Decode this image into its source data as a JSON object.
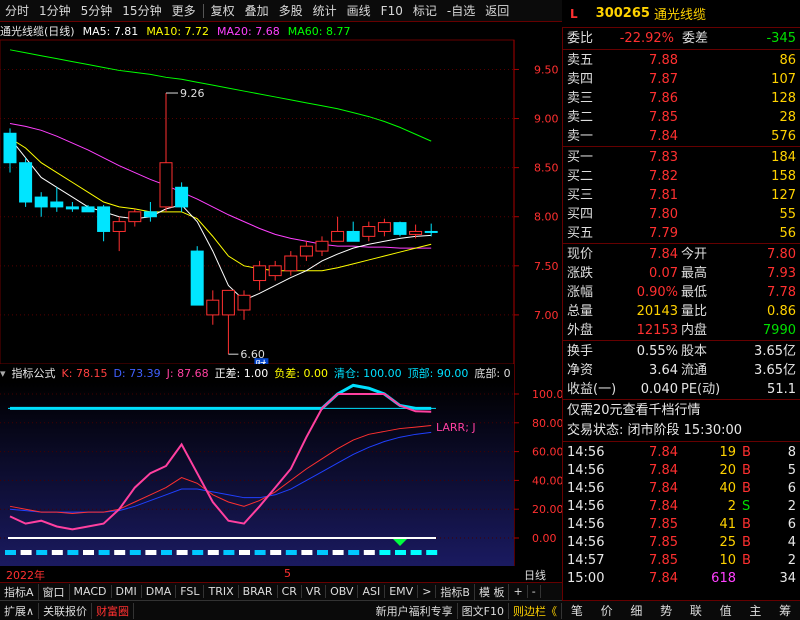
{
  "toolbar": {
    "items": [
      "分时",
      "1分钟",
      "5分钟",
      "15分钟",
      "更多",
      "复权",
      "叠加",
      "多股",
      "统计",
      "画线",
      "F10",
      "标记",
      "-自选",
      "返回"
    ]
  },
  "stock": {
    "market_flag": "L",
    "code": "300265",
    "name": "通光线缆"
  },
  "chart": {
    "title": "通光线缆(日线)",
    "ma5": "MA5: 7.81",
    "ma10": "MA10: 7.72",
    "ma20": "MA20: 7.68",
    "ma60": "MA60: 8.77",
    "high_label": "9.26",
    "low_label": "6.60",
    "fin_marker": "财",
    "price_ticks": [
      "9.50",
      "9.00",
      "8.50",
      "8.00",
      "7.50",
      "7.00"
    ],
    "colors": {
      "up": "#ff3030",
      "down": "#00e5ff",
      "ma5": "#ffffff",
      "ma10": "#ffff00",
      "ma20": "#ff40ff",
      "ma60": "#00ff00"
    }
  },
  "indicator": {
    "name": "指标公式",
    "k": "K: 78.15",
    "d": "D: 73.39",
    "j": "J: 87.68",
    "zhengcha": "正差: 1.00",
    "fucha": "负差: 0.00",
    "qingcang": "清仓: 100.00",
    "dingbu": "顶部: 90.00",
    "dibu": "底部: 0",
    "larr_label": "LARR; J",
    "ticks": [
      "100.0",
      "80.00",
      "60.00",
      "40.00",
      "20.00",
      "0.00"
    ]
  },
  "chart_data": {
    "type": "candlestick",
    "title": "通光线缆(日线)",
    "ylim": [
      6.5,
      9.8
    ],
    "ohlc": [
      [
        8.85,
        8.9,
        8.45,
        8.55
      ],
      [
        8.55,
        8.6,
        8.1,
        8.15
      ],
      [
        8.2,
        8.25,
        8.0,
        8.1
      ],
      [
        8.15,
        8.3,
        8.05,
        8.1
      ],
      [
        8.1,
        8.15,
        8.05,
        8.08
      ],
      [
        8.1,
        8.12,
        8.05,
        8.05
      ],
      [
        8.1,
        8.12,
        7.75,
        7.85
      ],
      [
        7.85,
        8.0,
        7.65,
        7.95
      ],
      [
        7.95,
        8.08,
        7.9,
        8.05
      ],
      [
        8.05,
        8.15,
        7.95,
        8.0
      ],
      [
        8.1,
        9.26,
        8.05,
        8.55
      ],
      [
        8.3,
        8.35,
        8.05,
        8.1
      ],
      [
        7.65,
        7.7,
        7.1,
        7.1
      ],
      [
        7.0,
        7.25,
        6.9,
        7.15
      ],
      [
        7.0,
        7.1,
        6.6,
        7.25
      ],
      [
        7.05,
        7.25,
        6.95,
        7.2
      ],
      [
        7.35,
        7.55,
        7.25,
        7.5
      ],
      [
        7.4,
        7.55,
        7.35,
        7.5
      ],
      [
        7.45,
        7.65,
        7.4,
        7.6
      ],
      [
        7.6,
        7.75,
        7.55,
        7.7
      ],
      [
        7.65,
        7.8,
        7.6,
        7.75
      ],
      [
        7.75,
        8.0,
        7.75,
        7.85
      ],
      [
        7.85,
        7.95,
        7.75,
        7.75
      ],
      [
        7.8,
        7.95,
        7.75,
        7.9
      ],
      [
        7.85,
        7.98,
        7.8,
        7.94
      ],
      [
        7.94,
        7.95,
        7.8,
        7.82
      ],
      [
        7.82,
        7.92,
        7.78,
        7.85
      ],
      [
        7.85,
        7.93,
        7.8,
        7.84
      ]
    ],
    "ma5": [
      8.8,
      8.6,
      8.4,
      8.3,
      8.2,
      8.1,
      8.05,
      8.0,
      7.98,
      8.0,
      8.08,
      8.12,
      7.95,
      7.65,
      7.3,
      7.15,
      7.22,
      7.3,
      7.38,
      7.45,
      7.55,
      7.62,
      7.68,
      7.72,
      7.75,
      7.78,
      7.8,
      7.81
    ],
    "ma10": [
      8.8,
      8.7,
      8.55,
      8.45,
      8.35,
      8.25,
      8.15,
      8.1,
      8.08,
      8.05,
      8.05,
      8.05,
      7.98,
      7.8,
      7.6,
      7.5,
      7.47,
      7.45,
      7.45,
      7.45,
      7.45,
      7.48,
      7.52,
      7.56,
      7.6,
      7.64,
      7.68,
      7.72
    ],
    "ma20": [
      8.95,
      8.92,
      8.88,
      8.82,
      8.75,
      8.68,
      8.6,
      8.52,
      8.45,
      8.38,
      8.32,
      8.25,
      8.18,
      8.1,
      8.02,
      7.95,
      7.88,
      7.82,
      7.78,
      7.75,
      7.72,
      7.7,
      7.7,
      7.69,
      7.69,
      7.68,
      7.68,
      7.68
    ],
    "ma60": [
      9.7,
      9.67,
      9.64,
      9.61,
      9.58,
      9.55,
      9.52,
      9.49,
      9.47,
      9.45,
      9.42,
      9.4,
      9.37,
      9.34,
      9.31,
      9.28,
      9.25,
      9.22,
      9.19,
      9.16,
      9.13,
      9.1,
      9.06,
      9.02,
      8.97,
      8.91,
      8.84,
      8.77
    ],
    "indicator_k": [
      22,
      20,
      18,
      18,
      17,
      18,
      18,
      20,
      25,
      30,
      35,
      42,
      38,
      30,
      25,
      22,
      26,
      32,
      40,
      48,
      55,
      62,
      68,
      72,
      74,
      76,
      77,
      78.15
    ],
    "indicator_d": [
      20,
      19,
      18,
      18,
      18,
      18,
      18,
      19,
      22,
      26,
      30,
      34,
      34,
      32,
      30,
      28,
      28,
      30,
      34,
      40,
      46,
      52,
      58,
      63,
      67,
      70,
      72,
      73.39
    ],
    "indicator_j": [
      15,
      10,
      12,
      8,
      6,
      8,
      10,
      20,
      35,
      45,
      50,
      65,
      45,
      25,
      12,
      10,
      22,
      35,
      48,
      70,
      90,
      100,
      106,
      104,
      100,
      92,
      88,
      87.68
    ]
  },
  "quote": {
    "weibi_label": "委比",
    "weibi": "-22.92%",
    "weicha_label": "委差",
    "weicha": "-345",
    "asks": [
      {
        "label": "卖五",
        "price": "7.88",
        "vol": "86"
      },
      {
        "label": "卖四",
        "price": "7.87",
        "vol": "107"
      },
      {
        "label": "卖三",
        "price": "7.86",
        "vol": "128"
      },
      {
        "label": "卖二",
        "price": "7.85",
        "vol": "28"
      },
      {
        "label": "卖一",
        "price": "7.84",
        "vol": "576"
      }
    ],
    "bids": [
      {
        "label": "买一",
        "price": "7.83",
        "vol": "184"
      },
      {
        "label": "买二",
        "price": "7.82",
        "vol": "158"
      },
      {
        "label": "买三",
        "price": "7.81",
        "vol": "127"
      },
      {
        "label": "买四",
        "price": "7.80",
        "vol": "55"
      },
      {
        "label": "买五",
        "price": "7.79",
        "vol": "56"
      }
    ],
    "stats": [
      {
        "l1": "现价",
        "v1": "7.84",
        "c1": "red",
        "l2": "今开",
        "v2": "7.80",
        "c2": "red"
      },
      {
        "l1": "涨跌",
        "v1": "0.07",
        "c1": "red",
        "l2": "最高",
        "v2": "7.93",
        "c2": "red"
      },
      {
        "l1": "涨幅",
        "v1": "0.90%",
        "c1": "red",
        "l2": "最低",
        "v2": "7.78",
        "c2": "red"
      },
      {
        "l1": "总量",
        "v1": "20143",
        "c1": "yellow",
        "l2": "量比",
        "v2": "0.86",
        "c2": "yellow"
      },
      {
        "l1": "外盘",
        "v1": "12153",
        "c1": "red",
        "l2": "内盘",
        "v2": "7990",
        "c2": "green"
      }
    ],
    "stats2": [
      {
        "l1": "换手",
        "v1": "0.55%",
        "c1": "white",
        "l2": "股本",
        "v2": "3.65亿",
        "c2": "white"
      },
      {
        "l1": "净资",
        "v1": "3.64",
        "c1": "white",
        "l2": "流通",
        "v2": "3.65亿",
        "c2": "white"
      },
      {
        "l1": "收益(一)",
        "v1": "0.040",
        "c1": "white",
        "l2": "PE(动)",
        "v2": "51.1",
        "c2": "white"
      }
    ],
    "promo": "仅需20元查看千档行情",
    "trade_state": "交易状态: 闭市阶段 15:30:00",
    "ticks": [
      {
        "t": "14:56",
        "p": "7.84",
        "v": "19",
        "s": "B",
        "n": "8"
      },
      {
        "t": "14:56",
        "p": "7.84",
        "v": "20",
        "s": "B",
        "n": "5"
      },
      {
        "t": "14:56",
        "p": "7.84",
        "v": "40",
        "s": "B",
        "n": "6"
      },
      {
        "t": "14:56",
        "p": "7.84",
        "v": "2",
        "s": "S",
        "n": "2"
      },
      {
        "t": "14:56",
        "p": "7.85",
        "v": "41",
        "s": "B",
        "n": "6"
      },
      {
        "t": "14:56",
        "p": "7.85",
        "v": "25",
        "s": "B",
        "n": "4"
      },
      {
        "t": "14:57",
        "p": "7.85",
        "v": "10",
        "s": "B",
        "n": "2"
      },
      {
        "t": "15:00",
        "p": "7.84",
        "v": "618",
        "s": "",
        "n": "34"
      }
    ]
  },
  "date_row": {
    "year": "2022年",
    "month": "5",
    "period": "日线"
  },
  "tabs": [
    "指标A",
    "窗口",
    "MACD",
    "DMI",
    "DMA",
    "FSL",
    "TRIX",
    "BRAR",
    "CR",
    "VR",
    "OBV",
    "ASI",
    "EMV",
    ">",
    "指标B",
    "模 板",
    "+",
    "-"
  ],
  "status": [
    "扩展∧",
    "关联报价",
    "财富圈",
    "新用户福利专享",
    "图文F10",
    "则边栏《"
  ],
  "nav": [
    "笔",
    "价",
    "细",
    "势",
    "联",
    "值",
    "主",
    "筹"
  ]
}
